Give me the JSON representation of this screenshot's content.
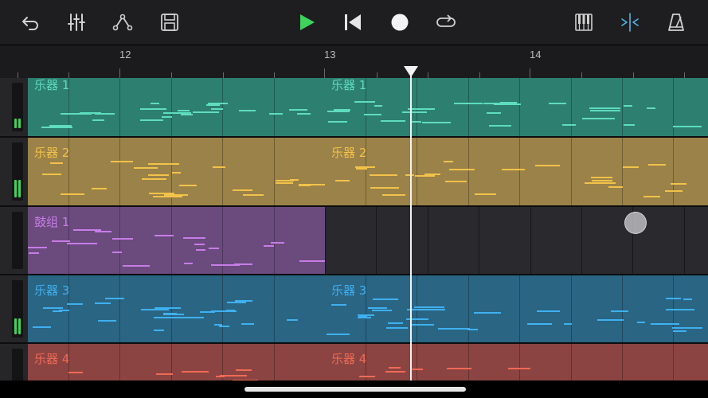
{
  "toolbar": {
    "buttons": [
      {
        "name": "undo",
        "icon": "undo-icon"
      },
      {
        "name": "mixer",
        "icon": "mixer-sliders-icon"
      },
      {
        "name": "automation",
        "icon": "automation-curve-icon"
      },
      {
        "name": "save",
        "icon": "save-icon"
      },
      {
        "name": "play",
        "icon": "play-icon"
      },
      {
        "name": "go-to-start",
        "icon": "skip-to-start-icon"
      },
      {
        "name": "record",
        "icon": "record-icon"
      },
      {
        "name": "loop",
        "icon": "loop-icon"
      },
      {
        "name": "keyboard",
        "icon": "piano-keys-icon"
      },
      {
        "name": "snap",
        "icon": "snap-icon"
      },
      {
        "name": "metronome",
        "icon": "metronome-icon"
      }
    ]
  },
  "ruler": {
    "bars": [
      "12",
      "13",
      "14"
    ]
  },
  "tracks": [
    {
      "id": "t1",
      "color": "#2d7f70",
      "regions": [
        {
          "label": "乐器 1"
        },
        {
          "label": "乐器 1"
        }
      ]
    },
    {
      "id": "t2",
      "color": "#9a8248",
      "regions": [
        {
          "label": "乐器 2"
        },
        {
          "label": "乐器 2"
        }
      ]
    },
    {
      "id": "t3",
      "color": "#6b4a7e",
      "regions": [
        {
          "label": "鼓组 1"
        }
      ]
    },
    {
      "id": "t4",
      "color": "#2a6583",
      "regions": [
        {
          "label": "乐器 3"
        },
        {
          "label": "乐器 3"
        }
      ]
    },
    {
      "id": "t5",
      "color": "#8b4442",
      "regions": [
        {
          "label": "乐器 4"
        },
        {
          "label": "乐器 4"
        }
      ]
    }
  ],
  "colors": {
    "play": "#3fd35c",
    "snap_active": "#4fb8e6",
    "t1_note": "#5fdcbf",
    "t2_note": "#f2c24a",
    "t3_note": "#c77de6",
    "t4_note": "#3fb0f0",
    "t5_note": "#f06a55"
  }
}
